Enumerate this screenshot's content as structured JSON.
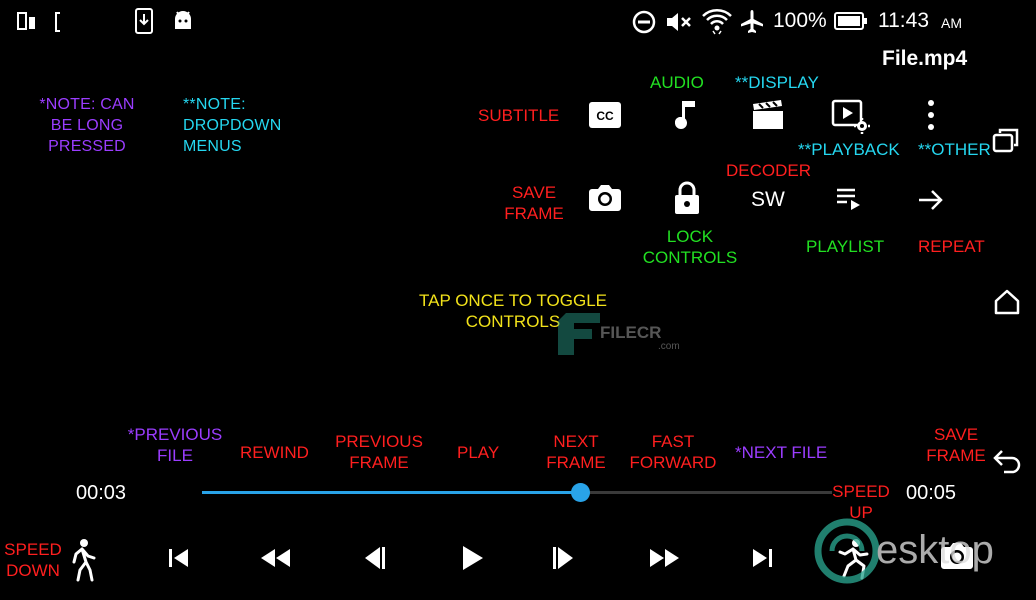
{
  "status_bar": {
    "battery": "100%",
    "time": "11:43",
    "ampm": "AM"
  },
  "title": "File.mp4",
  "notes": {
    "long_press": [
      "*NOTE: CAN",
      "BE LONG",
      "PRESSED"
    ],
    "dropdown": [
      "**NOTE:",
      "DROPDOWN",
      "MENUS"
    ]
  },
  "labels": {
    "subtitle": "SUBTITLE",
    "audio": "AUDIO",
    "display": "**DISPLAY",
    "playback": "**PLAYBACK",
    "other": "**OTHER",
    "decoder": "DECODER",
    "save_frame_top": [
      "SAVE",
      "FRAME"
    ],
    "lock": [
      "LOCK",
      "CONTROLS"
    ],
    "playlist": "PLAYLIST",
    "repeat": "REPEAT",
    "tap": [
      "TAP ONCE TO TOGGLE",
      "CONTROLS"
    ],
    "prev_file": [
      "*PREVIOUS",
      "FILE"
    ],
    "rewind": "REWIND",
    "prev_frame": [
      "PREVIOUS",
      "FRAME"
    ],
    "play": "PLAY",
    "next_frame": [
      "NEXT",
      "FRAME"
    ],
    "fast_forward": [
      "FAST",
      "FORWARD"
    ],
    "next_file": "*NEXT FILE",
    "save_frame_bottom": [
      "SAVE",
      "FRAME"
    ],
    "speed_up": [
      "SPEED",
      "UP"
    ],
    "speed_down": [
      "SPEED",
      "DOWN"
    ]
  },
  "decoder_value": "SW",
  "player": {
    "current_time": "00:03",
    "duration": "00:05",
    "progress": 0.6
  },
  "watermarks": {
    "filecr": "FILECR",
    "filecr_sub": ".com",
    "desktop": "esktop"
  },
  "colors": {
    "red": "#ff1f1f",
    "green": "#22e022",
    "cyan": "#25d7f0",
    "purple": "#9b3dff",
    "yellow": "#f2e21a",
    "seek": "#29a3e8"
  }
}
